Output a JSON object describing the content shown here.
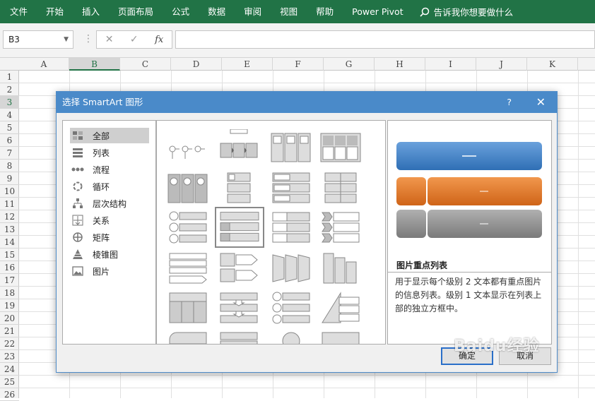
{
  "ribbon": {
    "tabs": [
      "文件",
      "开始",
      "插入",
      "页面布局",
      "公式",
      "数据",
      "审阅",
      "视图",
      "帮助",
      "Power Pivot"
    ],
    "tell_me": "告诉我你想要做什么"
  },
  "formula_bar": {
    "name_box": "B3",
    "fx": "fx",
    "value": ""
  },
  "grid": {
    "columns": [
      "A",
      "B",
      "C",
      "D",
      "E",
      "F",
      "G",
      "H",
      "I",
      "J",
      "K"
    ],
    "rows": [
      "1",
      "2",
      "3",
      "4",
      "5",
      "6",
      "7",
      "8",
      "9",
      "10",
      "11",
      "12",
      "13",
      "14",
      "15",
      "16",
      "17",
      "18",
      "19",
      "20",
      "21",
      "22",
      "23",
      "24",
      "25",
      "26"
    ],
    "selected_cell": "B3"
  },
  "dialog": {
    "title": "选择 SmartArt 图形",
    "help": "?",
    "close": "✕",
    "categories": [
      "全部",
      "列表",
      "流程",
      "循环",
      "层次结构",
      "关系",
      "矩阵",
      "棱锥图",
      "图片"
    ],
    "selected_category": "全部",
    "preview_title": "图片重点列表",
    "preview_desc": "用于显示每个级别 2 文本都有重点图片的信息列表。级别 1 文本显示在列表上部的独立方框中。",
    "ok": "确定",
    "cancel": "取消",
    "colors": {
      "accent1": "#4a86c8",
      "accent2": "#e07b2c",
      "gray": "#8c8c8c"
    }
  },
  "watermark": "Baidu经验"
}
